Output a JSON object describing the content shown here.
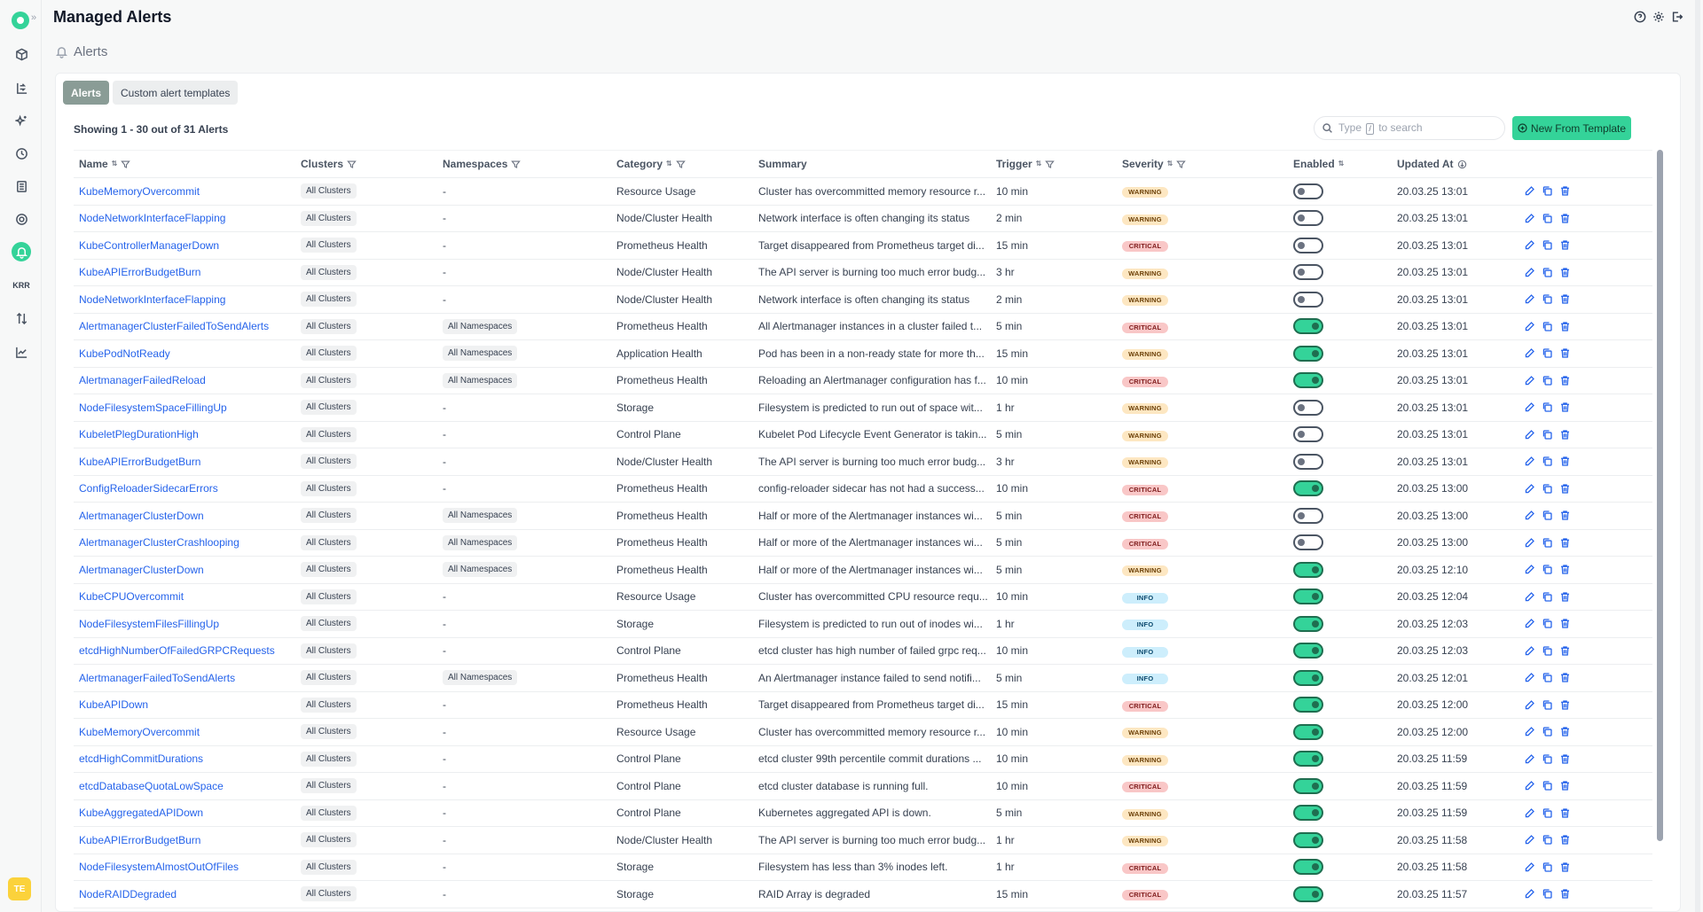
{
  "app": {
    "title": "Managed Alerts",
    "breadcrumb": "Alerts",
    "user_initials": "TE",
    "krr_label": "KRR"
  },
  "tabs": [
    {
      "label": "Alerts",
      "active": true
    },
    {
      "label": "Custom alert templates",
      "active": false
    }
  ],
  "toolbar": {
    "showing": "Showing 1 - 30 out of 31 Alerts",
    "search_prefix": "Type",
    "search_key": "/",
    "search_suffix": "to search",
    "new_button": "New From Template"
  },
  "columns": {
    "name": "Name",
    "clusters": "Clusters",
    "namespaces": "Namespaces",
    "category": "Category",
    "summary": "Summary",
    "trigger": "Trigger",
    "severity": "Severity",
    "enabled": "Enabled",
    "updated": "Updated At"
  },
  "colors": {
    "accent": "#34d399",
    "link": "#2563eb",
    "tab_active": "#8a9c96"
  },
  "rows": [
    {
      "name": "KubeMemoryOvercommit",
      "clusters": "All Clusters",
      "namespaces": "-",
      "category": "Resource Usage",
      "summary": "Cluster has overcommitted memory resource r...",
      "trigger": "10 min",
      "severity": "WARNING",
      "enabled": false,
      "updated": "20.03.25 13:01"
    },
    {
      "name": "NodeNetworkInterfaceFlapping",
      "clusters": "All Clusters",
      "namespaces": "-",
      "category": "Node/Cluster Health",
      "summary": "Network interface is often changing its status",
      "trigger": "2 min",
      "severity": "WARNING",
      "enabled": false,
      "updated": "20.03.25 13:01"
    },
    {
      "name": "KubeControllerManagerDown",
      "clusters": "All Clusters",
      "namespaces": "-",
      "category": "Prometheus Health",
      "summary": "Target disappeared from Prometheus target di...",
      "trigger": "15 min",
      "severity": "CRITICAL",
      "enabled": false,
      "updated": "20.03.25 13:01"
    },
    {
      "name": "KubeAPIErrorBudgetBurn",
      "clusters": "All Clusters",
      "namespaces": "-",
      "category": "Node/Cluster Health",
      "summary": "The API server is burning too much error budg...",
      "trigger": "3 hr",
      "severity": "WARNING",
      "enabled": false,
      "updated": "20.03.25 13:01"
    },
    {
      "name": "NodeNetworkInterfaceFlapping",
      "clusters": "All Clusters",
      "namespaces": "-",
      "category": "Node/Cluster Health",
      "summary": "Network interface is often changing its status",
      "trigger": "2 min",
      "severity": "WARNING",
      "enabled": false,
      "updated": "20.03.25 13:01"
    },
    {
      "name": "AlertmanagerClusterFailedToSendAlerts",
      "clusters": "All Clusters",
      "namespaces": "All Namespaces",
      "category": "Prometheus Health",
      "summary": "All Alertmanager instances in a cluster failed t...",
      "trigger": "5 min",
      "severity": "CRITICAL",
      "enabled": true,
      "updated": "20.03.25 13:01"
    },
    {
      "name": "KubePodNotReady",
      "clusters": "All Clusters",
      "namespaces": "All Namespaces",
      "category": "Application Health",
      "summary": "Pod has been in a non-ready state for more th...",
      "trigger": "15 min",
      "severity": "WARNING",
      "enabled": true,
      "updated": "20.03.25 13:01"
    },
    {
      "name": "AlertmanagerFailedReload",
      "clusters": "All Clusters",
      "namespaces": "All Namespaces",
      "category": "Prometheus Health",
      "summary": "Reloading an Alertmanager configuration has f...",
      "trigger": "10 min",
      "severity": "CRITICAL",
      "enabled": true,
      "updated": "20.03.25 13:01"
    },
    {
      "name": "NodeFilesystemSpaceFillingUp",
      "clusters": "All Clusters",
      "namespaces": "-",
      "category": "Storage",
      "summary": "Filesystem is predicted to run out of space wit...",
      "trigger": "1 hr",
      "severity": "WARNING",
      "enabled": false,
      "updated": "20.03.25 13:01"
    },
    {
      "name": "KubeletPlegDurationHigh",
      "clusters": "All Clusters",
      "namespaces": "-",
      "category": "Control Plane",
      "summary": "Kubelet Pod Lifecycle Event Generator is takin...",
      "trigger": "5 min",
      "severity": "WARNING",
      "enabled": false,
      "updated": "20.03.25 13:01"
    },
    {
      "name": "KubeAPIErrorBudgetBurn",
      "clusters": "All Clusters",
      "namespaces": "-",
      "category": "Node/Cluster Health",
      "summary": "The API server is burning too much error budg...",
      "trigger": "3 hr",
      "severity": "WARNING",
      "enabled": false,
      "updated": "20.03.25 13:01"
    },
    {
      "name": "ConfigReloaderSidecarErrors",
      "clusters": "All Clusters",
      "namespaces": "-",
      "category": "Prometheus Health",
      "summary": "config-reloader sidecar has not had a success...",
      "trigger": "10 min",
      "severity": "CRITICAL",
      "enabled": true,
      "updated": "20.03.25 13:00"
    },
    {
      "name": "AlertmanagerClusterDown",
      "clusters": "All Clusters",
      "namespaces": "All Namespaces",
      "category": "Prometheus Health",
      "summary": "Half or more of the Alertmanager instances wi...",
      "trigger": "5 min",
      "severity": "CRITICAL",
      "enabled": false,
      "updated": "20.03.25 13:00"
    },
    {
      "name": "AlertmanagerClusterCrashlooping",
      "clusters": "All Clusters",
      "namespaces": "All Namespaces",
      "category": "Prometheus Health",
      "summary": "Half or more of the Alertmanager instances wi...",
      "trigger": "5 min",
      "severity": "CRITICAL",
      "enabled": false,
      "updated": "20.03.25 13:00"
    },
    {
      "name": "AlertmanagerClusterDown",
      "clusters": "All Clusters",
      "namespaces": "All Namespaces",
      "category": "Prometheus Health",
      "summary": "Half or more of the Alertmanager instances wi...",
      "trigger": "5 min",
      "severity": "WARNING",
      "enabled": true,
      "updated": "20.03.25 12:10"
    },
    {
      "name": "KubeCPUOvercommit",
      "clusters": "All Clusters",
      "namespaces": "-",
      "category": "Resource Usage",
      "summary": "Cluster has overcommitted CPU resource requ...",
      "trigger": "10 min",
      "severity": "INFO",
      "enabled": true,
      "updated": "20.03.25 12:04"
    },
    {
      "name": "NodeFilesystemFilesFillingUp",
      "clusters": "All Clusters",
      "namespaces": "-",
      "category": "Storage",
      "summary": "Filesystem is predicted to run out of inodes wi...",
      "trigger": "1 hr",
      "severity": "INFO",
      "enabled": true,
      "updated": "20.03.25 12:03"
    },
    {
      "name": "etcdHighNumberOfFailedGRPCRequests",
      "clusters": "All Clusters",
      "namespaces": "-",
      "category": "Control Plane",
      "summary": "etcd cluster has high number of failed grpc req...",
      "trigger": "10 min",
      "severity": "INFO",
      "enabled": true,
      "updated": "20.03.25 12:03"
    },
    {
      "name": "AlertmanagerFailedToSendAlerts",
      "clusters": "All Clusters",
      "namespaces": "All Namespaces",
      "category": "Prometheus Health",
      "summary": "An Alertmanager instance failed to send notifi...",
      "trigger": "5 min",
      "severity": "INFO",
      "enabled": true,
      "updated": "20.03.25 12:01"
    },
    {
      "name": "KubeAPIDown",
      "clusters": "All Clusters",
      "namespaces": "-",
      "category": "Prometheus Health",
      "summary": "Target disappeared from Prometheus target di...",
      "trigger": "15 min",
      "severity": "CRITICAL",
      "enabled": true,
      "updated": "20.03.25 12:00"
    },
    {
      "name": "KubeMemoryOvercommit",
      "clusters": "All Clusters",
      "namespaces": "-",
      "category": "Resource Usage",
      "summary": "Cluster has overcommitted memory resource r...",
      "trigger": "10 min",
      "severity": "WARNING",
      "enabled": true,
      "updated": "20.03.25 12:00"
    },
    {
      "name": "etcdHighCommitDurations",
      "clusters": "All Clusters",
      "namespaces": "-",
      "category": "Control Plane",
      "summary": "etcd cluster 99th percentile commit durations ...",
      "trigger": "10 min",
      "severity": "WARNING",
      "enabled": true,
      "updated": "20.03.25 11:59"
    },
    {
      "name": "etcdDatabaseQuotaLowSpace",
      "clusters": "All Clusters",
      "namespaces": "-",
      "category": "Control Plane",
      "summary": "etcd cluster database is running full.",
      "trigger": "10 min",
      "severity": "CRITICAL",
      "enabled": true,
      "updated": "20.03.25 11:59"
    },
    {
      "name": "KubeAggregatedAPIDown",
      "clusters": "All Clusters",
      "namespaces": "-",
      "category": "Control Plane",
      "summary": "Kubernetes aggregated API is down.",
      "trigger": "5 min",
      "severity": "WARNING",
      "enabled": true,
      "updated": "20.03.25 11:59"
    },
    {
      "name": "KubeAPIErrorBudgetBurn",
      "clusters": "All Clusters",
      "namespaces": "-",
      "category": "Node/Cluster Health",
      "summary": "The API server is burning too much error budg...",
      "trigger": "1 hr",
      "severity": "WARNING",
      "enabled": true,
      "updated": "20.03.25 11:58"
    },
    {
      "name": "NodeFilesystemAlmostOutOfFiles",
      "clusters": "All Clusters",
      "namespaces": "-",
      "category": "Storage",
      "summary": "Filesystem has less than 3% inodes left.",
      "trigger": "1 hr",
      "severity": "CRITICAL",
      "enabled": true,
      "updated": "20.03.25 11:58"
    },
    {
      "name": "NodeRAIDDegraded",
      "clusters": "All Clusters",
      "namespaces": "-",
      "category": "Storage",
      "summary": "RAID Array is degraded",
      "trigger": "15 min",
      "severity": "CRITICAL",
      "enabled": true,
      "updated": "20.03.25 11:57"
    }
  ]
}
